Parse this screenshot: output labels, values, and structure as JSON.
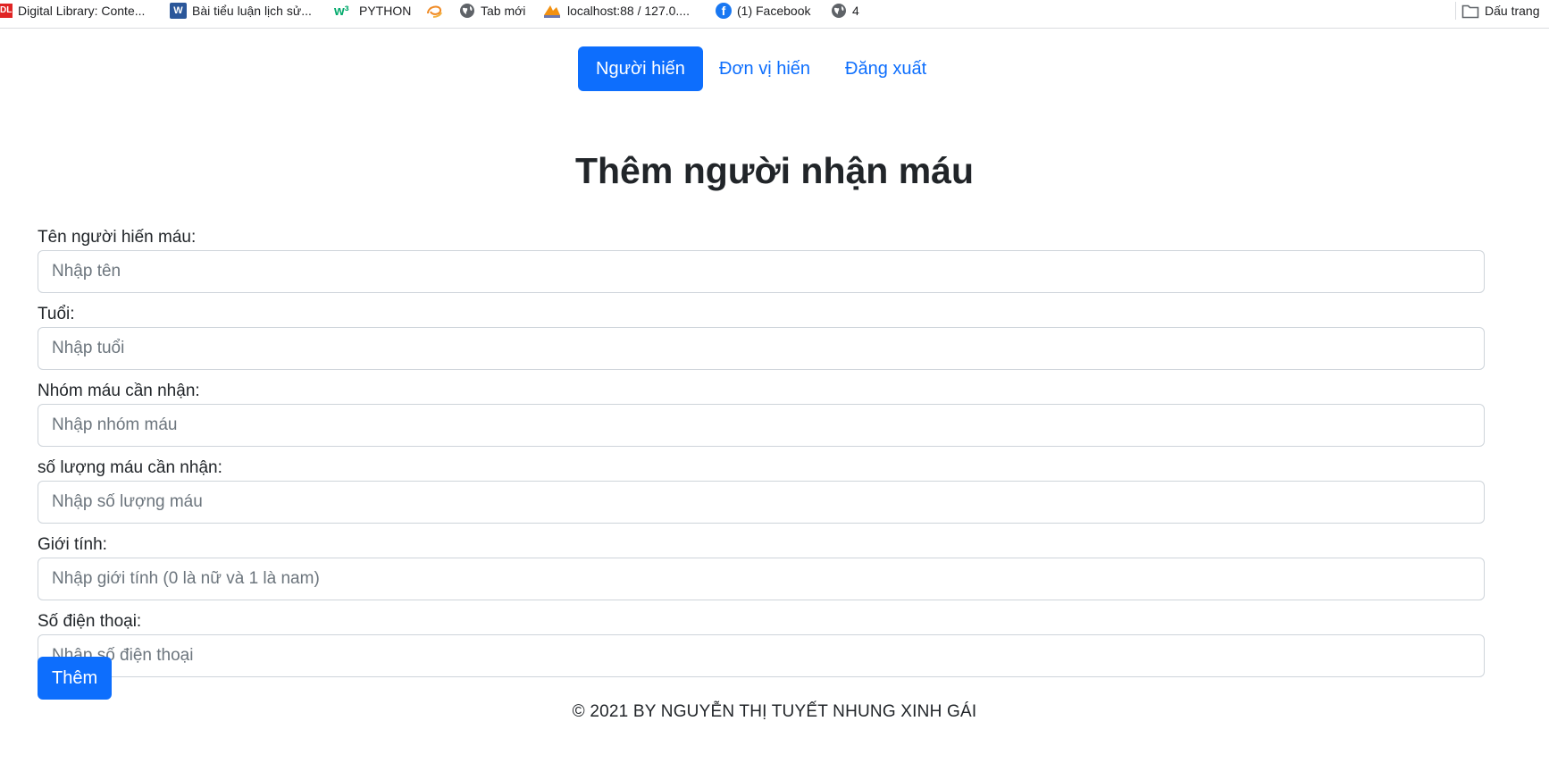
{
  "bookmarks": [
    {
      "icon": "dl-icon",
      "label": "Digital Library: Conte..."
    },
    {
      "icon": "word-icon",
      "label": "Bài tiểu luận lịch sử..."
    },
    {
      "icon": "w3schools-icon",
      "label": "PYTHON"
    },
    {
      "icon": "swirl-icon",
      "label": ""
    },
    {
      "icon": "globe-icon",
      "label": "Tab mới"
    },
    {
      "icon": "phpmyadmin-icon",
      "label": "localhost:88 / 127.0...."
    },
    {
      "icon": "facebook-icon",
      "label": "(1) Facebook"
    },
    {
      "icon": "globe-icon",
      "label": "4"
    },
    {
      "icon": "folder-icon",
      "label": "Dấu trang"
    }
  ],
  "nav": {
    "items": [
      "Người hiến",
      "Đơn vị hiến",
      "Đăng xuất"
    ],
    "active_index": 0,
    "active_color": "#0d6efd"
  },
  "page": {
    "title": "Thêm người nhận máu"
  },
  "form": {
    "fields": [
      {
        "label": "Tên người hiến máu:",
        "placeholder": "Nhập tên",
        "value": ""
      },
      {
        "label": "Tuổi:",
        "placeholder": "Nhập tuổi",
        "value": ""
      },
      {
        "label": "Nhóm máu cần nhận:",
        "placeholder": "Nhập nhóm máu",
        "value": ""
      },
      {
        "label": "số lượng máu cần nhận:",
        "placeholder": "Nhập số lượng máu",
        "value": ""
      },
      {
        "label": "Giới tính:",
        "placeholder": "Nhập giới tính (0 là nữ và 1 là nam)",
        "value": ""
      },
      {
        "label": "Số điện thoại:",
        "placeholder": "Nhập số điện thoại",
        "value": ""
      }
    ],
    "submit_label": "Thêm"
  },
  "footer": {
    "text": "© 2021 BY NGUYỄN THỊ TUYẾT NHUNG XINH GÁI"
  }
}
